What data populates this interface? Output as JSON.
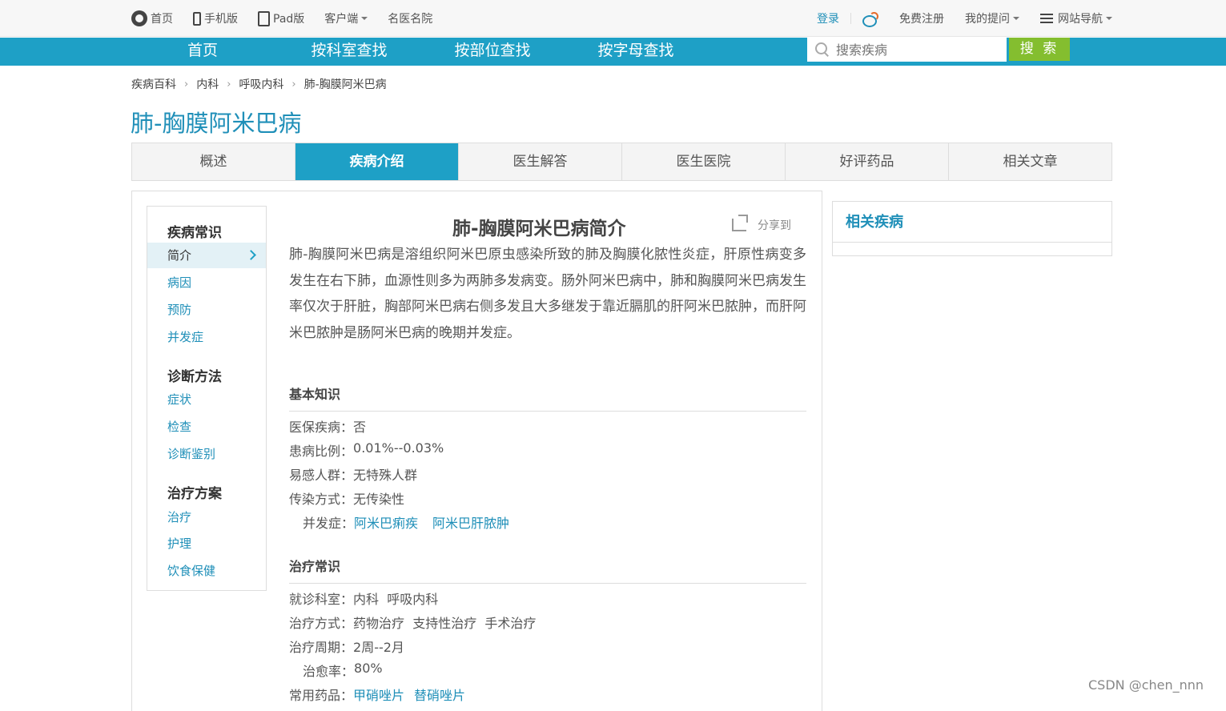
{
  "topbar": {
    "home": "首页",
    "mobile": "手机版",
    "pad": "Pad版",
    "client": "客户端",
    "famous_doctors": "名医名院",
    "login": "登录",
    "register": "免费注册",
    "my_questions": "我的提问",
    "site_nav": "网站导航"
  },
  "nav": {
    "items": [
      "首页",
      "按科室查找",
      "按部位查找",
      "按字母查找"
    ],
    "search_placeholder": "搜索疾病",
    "search_button": "搜 索"
  },
  "breadcrumb": [
    "疾病百科",
    "内科",
    "呼吸内科",
    "肺-胸膜阿米巴病"
  ],
  "page_title": "肺-胸膜阿米巴病",
  "tabs": [
    "概述",
    "疾病介绍",
    "医生解答",
    "医生医院",
    "好评药品",
    "相关文章"
  ],
  "active_tab": "疾病介绍",
  "sidebar": {
    "groups": [
      {
        "title": "疾病常识",
        "items": [
          "简介",
          "病因",
          "预防",
          "并发症"
        ]
      },
      {
        "title": "诊断方法",
        "items": [
          "症状",
          "检查",
          "诊断鉴别"
        ]
      },
      {
        "title": "治疗方案",
        "items": [
          "治疗",
          "护理",
          "饮食保健"
        ]
      }
    ],
    "active_item": "简介"
  },
  "intro": {
    "title": "肺-胸膜阿米巴病简介",
    "share_label": "分享到",
    "text": "肺-胸膜阿米巴病是溶组织阿米巴原虫感染所致的肺及胸膜化脓性炎症，肝原性病变多发生在右下肺，血源性则多为两肺多发病变。肠外阿米巴病中，肺和胸膜阿米巴病发生率仅次于肝脏，胸部阿米巴病右侧多发且大多继发于靠近膈肌的肝阿米巴脓肿，而肝阿米巴脓肿是肠阿米巴病的晚期并发症。"
  },
  "basic_knowledge": {
    "heading": "基本知识",
    "insurance_label": "医保疾病：",
    "insurance_value": "否",
    "prevalence_label": "患病比例：",
    "prevalence_value": "0.01%--0.03%",
    "susceptible_label": "易感人群：",
    "susceptible_value": "无特殊人群",
    "transmission_label": "传染方式：",
    "transmission_value": "无传染性",
    "complications_label": "并发症：",
    "complications": [
      "阿米巴痢疾",
      "阿米巴肝脓肿"
    ]
  },
  "treatment": {
    "heading": "治疗常识",
    "department_label": "就诊科室：",
    "department_value": "内科  呼吸内科",
    "method_label": "治疗方式：",
    "method_value": "药物治疗  支持性治疗  手术治疗",
    "cycle_label": "治疗周期：",
    "cycle_value": "2周--2月",
    "cure_rate_label": "治愈率：",
    "cure_rate_value": "80%",
    "drugs_label": "常用药品：",
    "drugs": [
      "甲硝唑片",
      "替硝唑片"
    ]
  },
  "related": {
    "heading": "相关疾病"
  },
  "watermark": "CSDN @chen_nnn",
  "colors": {
    "accent": "#1ea0c6",
    "link": "#1f8fb8",
    "search_button": "#84be2f"
  }
}
